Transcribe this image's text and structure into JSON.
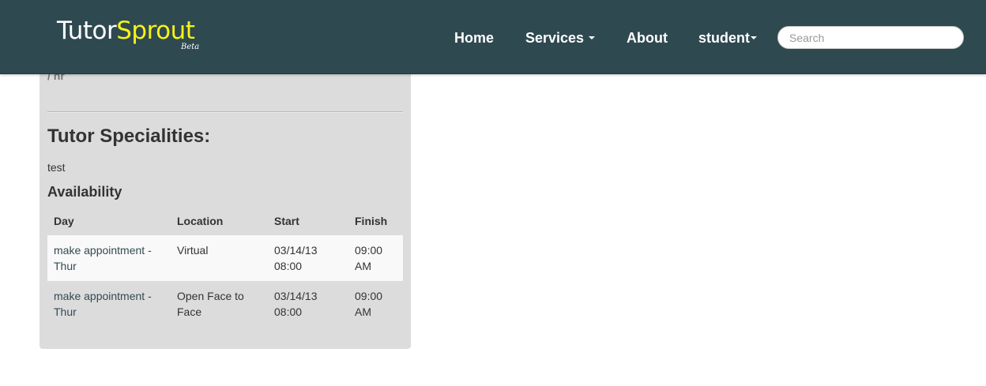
{
  "navbar": {
    "brand": {
      "part1": "Tutor",
      "part2": "Sprout",
      "beta": "Beta"
    },
    "links": {
      "home": "Home",
      "services": "Services",
      "about": "About",
      "user": "student"
    },
    "search": {
      "placeholder": "Search",
      "value": ""
    },
    "colors": {
      "background": "#2f4950",
      "brand_accent": "#f5f317"
    }
  },
  "panel": {
    "rate_text": "/ hr",
    "specialities_heading": "Tutor Specialities:",
    "specialities_value": "test",
    "availability_heading": "Availability",
    "table": {
      "headers": {
        "day": "Day",
        "location": "Location",
        "start": "Start",
        "finish": "Finish"
      },
      "rows": [
        {
          "day": "make appointment - Thur",
          "location": "Virtual",
          "start": "03/14/13 08:00",
          "finish": "09:00 AM"
        },
        {
          "day": "make appointment - Thur",
          "location": "Open Face to Face",
          "start": "03/14/13 08:00",
          "finish": "09:00 AM"
        }
      ]
    },
    "colors": {
      "background": "#dcdcdc"
    }
  }
}
